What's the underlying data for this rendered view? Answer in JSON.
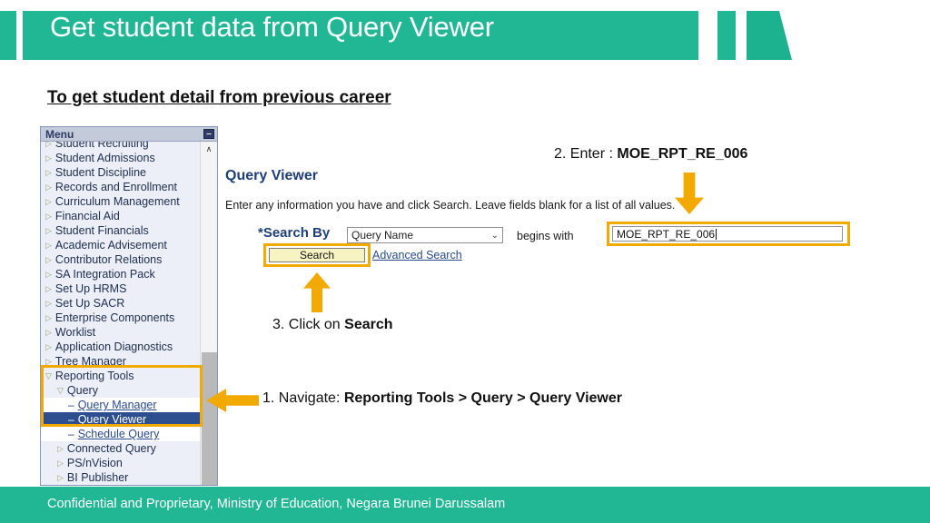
{
  "header": {
    "title": "Get student data from Query Viewer",
    "band_color": "#21b795"
  },
  "subtitle": "To get student detail from previous career",
  "menu": {
    "panel_title": "Menu",
    "collapse_icon_label": "–",
    "scroll_up_icon": "∧",
    "items": [
      {
        "label": "Student Recruiting",
        "level": 1,
        "marker": "▷"
      },
      {
        "label": "Student Admissions",
        "level": 1,
        "marker": "▷"
      },
      {
        "label": "Student Discipline",
        "level": 1,
        "marker": "▷"
      },
      {
        "label": "Records and Enrollment",
        "level": 1,
        "marker": "▷"
      },
      {
        "label": "Curriculum Management",
        "level": 1,
        "marker": "▷"
      },
      {
        "label": "Financial Aid",
        "level": 1,
        "marker": "▷"
      },
      {
        "label": "Student Financials",
        "level": 1,
        "marker": "▷"
      },
      {
        "label": "Academic Advisement",
        "level": 1,
        "marker": "▷"
      },
      {
        "label": "Contributor Relations",
        "level": 1,
        "marker": "▷"
      },
      {
        "label": "SA Integration Pack",
        "level": 1,
        "marker": "▷"
      },
      {
        "label": "Set Up HRMS",
        "level": 1,
        "marker": "▷"
      },
      {
        "label": "Set Up SACR",
        "level": 1,
        "marker": "▷"
      },
      {
        "label": "Enterprise Components",
        "level": 1,
        "marker": "▷"
      },
      {
        "label": "Worklist",
        "level": 1,
        "marker": "▷"
      },
      {
        "label": "Application Diagnostics",
        "level": 1,
        "marker": "▷"
      },
      {
        "label": "Tree Manager",
        "level": 1,
        "marker": "▷"
      },
      {
        "label": "Reporting Tools",
        "level": 1,
        "marker": "▽"
      },
      {
        "label": "Query",
        "level": 2,
        "marker": "▽"
      },
      {
        "label": "Query Manager",
        "level": 3,
        "marker": "–",
        "link": true
      },
      {
        "label": "Query Viewer",
        "level": 3,
        "marker": "–",
        "selected": true
      },
      {
        "label": "Schedule Query",
        "level": 3,
        "marker": "–",
        "link": true
      },
      {
        "label": "Connected Query",
        "level": 2,
        "marker": "▷"
      },
      {
        "label": "PS/nVision",
        "level": 2,
        "marker": "▷"
      },
      {
        "label": "BI Publisher",
        "level": 2,
        "marker": "▷"
      }
    ]
  },
  "query_viewer": {
    "title": "Query Viewer",
    "instruction": "Enter any information you have and click Search. Leave fields blank for a list of all values.",
    "search_by_label": "*Search By",
    "search_by_value": "Query Name",
    "search_by_chevron": "⌄",
    "operator_label": "begins with",
    "value_input": "MOE_RPT_RE_006",
    "search_button_label": "Search",
    "advanced_search_link": "Advanced Search"
  },
  "annotations": {
    "step2_prefix": "2. Enter : ",
    "step2_bold": "MOE_RPT_RE_006",
    "step3_prefix": "3. Click on ",
    "step3_bold": "Search",
    "step1_prefix": "1. Navigate: ",
    "step1_bold": "Reporting Tools > Query > Query Viewer",
    "highlight_color": "#f2a900"
  },
  "footer": {
    "text": "Confidential and Proprietary, Ministry of Education, Negara Brunei Darussalam"
  }
}
